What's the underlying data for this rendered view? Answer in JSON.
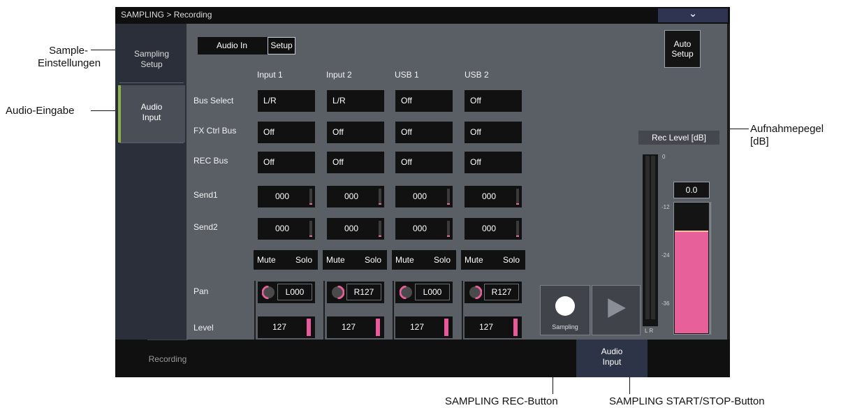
{
  "callouts": {
    "sample_settings": "Sample-\nEinstellungen",
    "audio_input": "Audio-Eingabe",
    "rec_level": "Aufnahmepegel\n[dB]",
    "rec_button": "SAMPLING REC-Button",
    "start_stop_button": "SAMPLING START/STOP-Button"
  },
  "screen": {
    "breadcrumb": "SAMPLING > Recording",
    "collapse_icon": "chevron-down-icon",
    "sidebar": [
      {
        "label": "Sampling\nSetup",
        "active": false
      },
      {
        "label": "Audio\nInput",
        "active": true
      }
    ],
    "segment": {
      "left": "Audio In",
      "right": "Setup",
      "selected": "Setup"
    },
    "auto_setup": "Auto\nSetup",
    "columns": [
      "Input 1",
      "Input 2",
      "USB 1",
      "USB 2"
    ],
    "row_labels": {
      "bus_select": "Bus Select",
      "fx_ctrl_bus": "FX Ctrl Bus",
      "rec_bus": "REC Bus",
      "send1": "Send1",
      "send2": "Send2",
      "pan": "Pan",
      "level": "Level"
    },
    "bus_select": [
      "L/R",
      "L/R",
      "Off",
      "Off"
    ],
    "fx_ctrl_bus": [
      "Off",
      "Off",
      "Off",
      "Off"
    ],
    "rec_bus": [
      "Off",
      "Off",
      "Off",
      "Off"
    ],
    "send1": [
      "000",
      "000",
      "000",
      "000"
    ],
    "send2": [
      "000",
      "000",
      "000",
      "000"
    ],
    "mute_label": "Mute",
    "solo_label": "Solo",
    "pan": [
      "L000",
      "R127",
      "L000",
      "R127"
    ],
    "level": [
      "127",
      "127",
      "127",
      "127"
    ],
    "level_fill_fraction": 1.0,
    "sampling_label": "Sampling",
    "rec_level": {
      "title": "Rec Level [dB]",
      "value": "0.0",
      "scale": [
        "0",
        "-12",
        "-24",
        "-36"
      ],
      "lr": "L R",
      "slider_fraction": 0.78,
      "colors": {
        "fill": "#e8609a",
        "marker": "#f5c3a0"
      }
    },
    "bottom_tabs": [
      {
        "label": "Recording",
        "active": false
      },
      {
        "label": "Audio\nInput",
        "active": true
      }
    ]
  }
}
